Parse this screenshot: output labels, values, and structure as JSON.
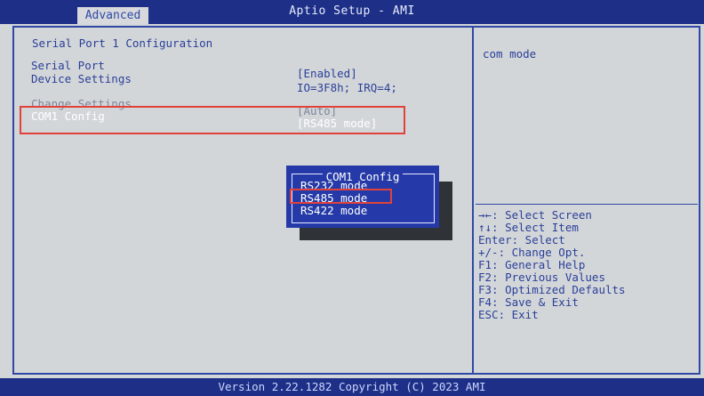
{
  "header": {
    "title": "Aptio Setup - AMI",
    "active_tab": "Advanced"
  },
  "page": {
    "section_title": "Serial Port 1 Configuration",
    "items": [
      {
        "label": "Serial Port",
        "value": "[Enabled]"
      },
      {
        "label": "Device Settings",
        "value": "IO=3F8h; IRQ=4;"
      },
      {
        "label": "Change Settings",
        "value": "[Auto]"
      },
      {
        "label": "COM1 Config",
        "value": "[RS485 mode]"
      }
    ]
  },
  "popup": {
    "title": "COM1 Config",
    "options": [
      "RS232 mode",
      "RS485 mode",
      "RS422 mode"
    ],
    "selected": "RS485 mode"
  },
  "help": {
    "description": "com mode",
    "keys": [
      "→←: Select Screen",
      "↑↓: Select Item",
      "Enter: Select",
      "+/-: Change Opt.",
      "F1: General Help",
      "F2: Previous Values",
      "F3: Optimized Defaults",
      "F4: Save & Exit",
      "ESC: Exit"
    ]
  },
  "footer": {
    "text": "Version 2.22.1282 Copyright (C) 2023 AMI"
  },
  "colors": {
    "header_bg": "#1d2f86",
    "panel_bg": "#d3d6d9",
    "label_text": "#2a3f98",
    "popup_bg": "#253aa8",
    "highlight_box": "#e0423a"
  }
}
